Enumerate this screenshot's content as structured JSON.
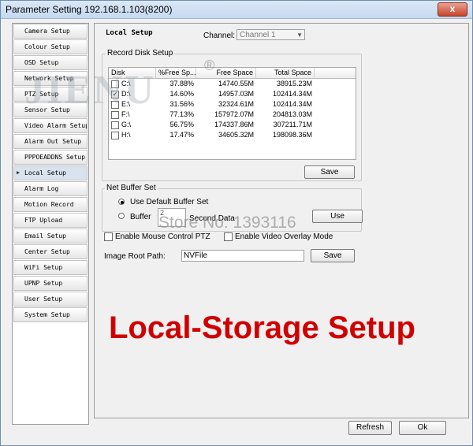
{
  "window": {
    "title": "Parameter Setting 192.168.1.103(8200)",
    "close_glyph": "x"
  },
  "sidebar": {
    "items": [
      {
        "label": "Camera Setup"
      },
      {
        "label": "Colour Setup"
      },
      {
        "label": "OSD Setup"
      },
      {
        "label": "Network Setup"
      },
      {
        "label": "PTZ Setup"
      },
      {
        "label": "Sensor Setup"
      },
      {
        "label": "Video Alarm Setup"
      },
      {
        "label": "Alarm Out Setup"
      },
      {
        "label": "PPPOEADDNS Setup"
      },
      {
        "label": "Local Setup",
        "active": true
      },
      {
        "label": "Alarm Log"
      },
      {
        "label": "Motion Record"
      },
      {
        "label": "FTP Upload"
      },
      {
        "label": "Email Setup"
      },
      {
        "label": "Center Setup"
      },
      {
        "label": "WiFi Setup"
      },
      {
        "label": "UPNP Setup"
      },
      {
        "label": "User Setup"
      },
      {
        "label": "System Setup"
      }
    ]
  },
  "local_setup": {
    "heading": "Local Setup",
    "channel_label": "Channel:",
    "channel_value": "Channel 1",
    "record_disk": {
      "legend": "Record Disk Setup",
      "columns": [
        "Disk",
        "%Free Sp...",
        "Free Space",
        "Total Space"
      ],
      "rows": [
        {
          "disk": "C:\\",
          "checked": false,
          "pct": "37.88%",
          "free": "14740.55M",
          "total": "38915.23M"
        },
        {
          "disk": "D:\\",
          "checked": true,
          "pct": "14.60%",
          "free": "14957.03M",
          "total": "102414.34M"
        },
        {
          "disk": "E:\\",
          "checked": false,
          "pct": "31.56%",
          "free": "32324.61M",
          "total": "102414.34M"
        },
        {
          "disk": "F:\\",
          "checked": false,
          "pct": "77.13%",
          "free": "157972.07M",
          "total": "204813.03M"
        },
        {
          "disk": "G:\\",
          "checked": false,
          "pct": "56.75%",
          "free": "174337.86M",
          "total": "307211.71M"
        },
        {
          "disk": "H:\\",
          "checked": false,
          "pct": "17.47%",
          "free": "34605.32M",
          "total": "198098.36M"
        }
      ],
      "save_label": "Save"
    },
    "net_buffer": {
      "legend": "Net Buffer Set",
      "default_label": "Use Default Buffer Set",
      "buffer_label": "Buffer",
      "buffer_value": "2",
      "second_label": "Second Data",
      "use_label": "Use"
    },
    "mouse_ptz_label": "Enable Mouse Control PTZ",
    "video_overlay_label": "Enable Video Overlay Mode",
    "image_root_label": "Image Root Path:",
    "image_root_value": "NVFile",
    "save_label": "Save",
    "refresh_label": "Refresh",
    "ok_label": "Ok"
  },
  "overlay": {
    "store_watermark": "Store No: 1393116",
    "caption": "Local-Storage Setup",
    "logo_text": "JIENU",
    "registered_mark": "®"
  },
  "colors": {
    "caption_red": "#d10000",
    "title_bg": "#c5d9ef"
  }
}
